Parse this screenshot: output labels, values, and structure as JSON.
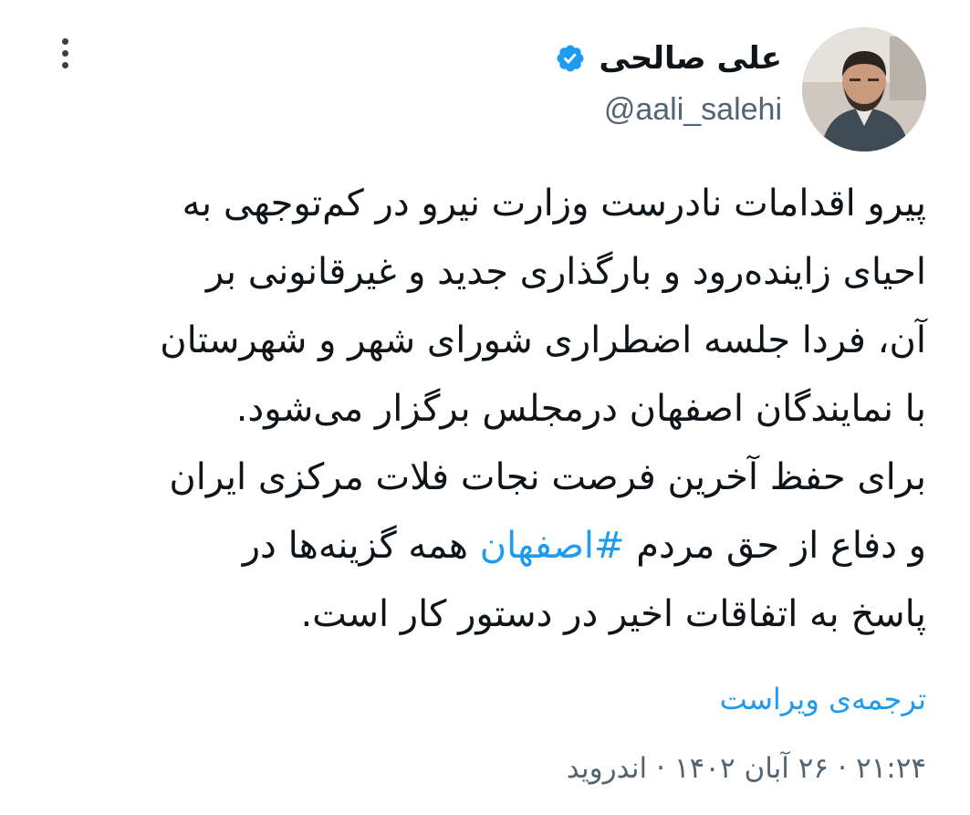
{
  "author": {
    "display_name": "علی صالحی",
    "handle": "@aali_salehi",
    "verified": true
  },
  "icons": {
    "more": "more-vertical-icon",
    "verified": "verified-badge-icon"
  },
  "colors": {
    "accent": "#1d9bf0",
    "text": "#0f1419",
    "secondary": "#536471"
  },
  "tweet": {
    "lines": [
      "پیرو اقدامات نادرست وزارت نیرو در کم‌توجهی به",
      "احیای زاینده‌رود و بارگذاری جدید و غیرقانونی بر",
      "آن، فردا جلسه اضطراری شورای شهر و شهرستان",
      "با نمایندگان اصفهان در‌مجلس برگزار می‌شود.",
      "برای حفظ آخرین فرصت نجات فلات مرکزی ایران"
    ],
    "line6_before": "و دفاع از حق مردم ",
    "hashtag": "#اصفهان",
    "line6_after": " همه گزینه‌ها در",
    "line7": "پاسخ به اتفاقات اخیر در دستور کار است."
  },
  "translate_label": "ترجمه‌ی ویراست",
  "meta": {
    "time": "۲۱:۲۴",
    "date": "۲۶ آبان ۱۴۰۲",
    "source": "اندروید",
    "separator": "·"
  }
}
